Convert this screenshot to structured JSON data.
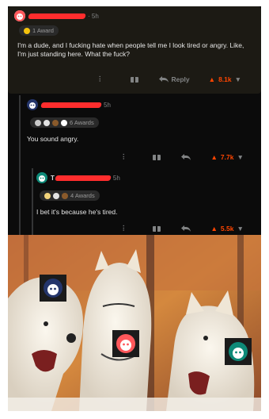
{
  "comments": [
    {
      "time": "· 5h",
      "awards_label": "1 Award",
      "text": "I'm a dude, and I fucking hate when people tell me I look tired or angry. Like, I'm just standing here. What the fuck?",
      "reply_label": "Reply",
      "score": "8.1k"
    },
    {
      "time": "5h",
      "awards_label": "6 Awards",
      "text": "You sound angry.",
      "score": "7.7k"
    },
    {
      "initial": "T",
      "time": "5h",
      "awards_label": "4 Awards",
      "text": "I bet it's because he's tired.",
      "score": "5.5k"
    }
  ],
  "icons": {
    "upvote": "▲",
    "downvote": "▼",
    "more": "⋮",
    "award": "gift-icon",
    "reply": "reply-arrow-icon"
  },
  "colors": {
    "accent": "#ff4500",
    "background": "#0b0b0b",
    "highlight": "#1c1a14",
    "redaction": "#ff2d2d"
  }
}
